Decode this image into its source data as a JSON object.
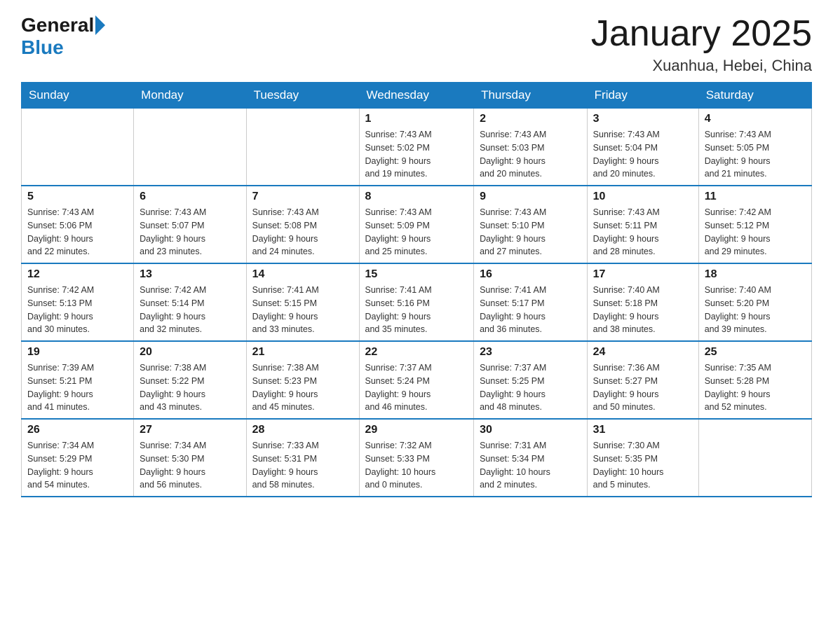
{
  "logo": {
    "general": "General",
    "blue": "Blue"
  },
  "title": "January 2025",
  "location": "Xuanhua, Hebei, China",
  "days_of_week": [
    "Sunday",
    "Monday",
    "Tuesday",
    "Wednesday",
    "Thursday",
    "Friday",
    "Saturday"
  ],
  "weeks": [
    [
      {
        "day": "",
        "info": ""
      },
      {
        "day": "",
        "info": ""
      },
      {
        "day": "",
        "info": ""
      },
      {
        "day": "1",
        "info": "Sunrise: 7:43 AM\nSunset: 5:02 PM\nDaylight: 9 hours\nand 19 minutes."
      },
      {
        "day": "2",
        "info": "Sunrise: 7:43 AM\nSunset: 5:03 PM\nDaylight: 9 hours\nand 20 minutes."
      },
      {
        "day": "3",
        "info": "Sunrise: 7:43 AM\nSunset: 5:04 PM\nDaylight: 9 hours\nand 20 minutes."
      },
      {
        "day": "4",
        "info": "Sunrise: 7:43 AM\nSunset: 5:05 PM\nDaylight: 9 hours\nand 21 minutes."
      }
    ],
    [
      {
        "day": "5",
        "info": "Sunrise: 7:43 AM\nSunset: 5:06 PM\nDaylight: 9 hours\nand 22 minutes."
      },
      {
        "day": "6",
        "info": "Sunrise: 7:43 AM\nSunset: 5:07 PM\nDaylight: 9 hours\nand 23 minutes."
      },
      {
        "day": "7",
        "info": "Sunrise: 7:43 AM\nSunset: 5:08 PM\nDaylight: 9 hours\nand 24 minutes."
      },
      {
        "day": "8",
        "info": "Sunrise: 7:43 AM\nSunset: 5:09 PM\nDaylight: 9 hours\nand 25 minutes."
      },
      {
        "day": "9",
        "info": "Sunrise: 7:43 AM\nSunset: 5:10 PM\nDaylight: 9 hours\nand 27 minutes."
      },
      {
        "day": "10",
        "info": "Sunrise: 7:43 AM\nSunset: 5:11 PM\nDaylight: 9 hours\nand 28 minutes."
      },
      {
        "day": "11",
        "info": "Sunrise: 7:42 AM\nSunset: 5:12 PM\nDaylight: 9 hours\nand 29 minutes."
      }
    ],
    [
      {
        "day": "12",
        "info": "Sunrise: 7:42 AM\nSunset: 5:13 PM\nDaylight: 9 hours\nand 30 minutes."
      },
      {
        "day": "13",
        "info": "Sunrise: 7:42 AM\nSunset: 5:14 PM\nDaylight: 9 hours\nand 32 minutes."
      },
      {
        "day": "14",
        "info": "Sunrise: 7:41 AM\nSunset: 5:15 PM\nDaylight: 9 hours\nand 33 minutes."
      },
      {
        "day": "15",
        "info": "Sunrise: 7:41 AM\nSunset: 5:16 PM\nDaylight: 9 hours\nand 35 minutes."
      },
      {
        "day": "16",
        "info": "Sunrise: 7:41 AM\nSunset: 5:17 PM\nDaylight: 9 hours\nand 36 minutes."
      },
      {
        "day": "17",
        "info": "Sunrise: 7:40 AM\nSunset: 5:18 PM\nDaylight: 9 hours\nand 38 minutes."
      },
      {
        "day": "18",
        "info": "Sunrise: 7:40 AM\nSunset: 5:20 PM\nDaylight: 9 hours\nand 39 minutes."
      }
    ],
    [
      {
        "day": "19",
        "info": "Sunrise: 7:39 AM\nSunset: 5:21 PM\nDaylight: 9 hours\nand 41 minutes."
      },
      {
        "day": "20",
        "info": "Sunrise: 7:38 AM\nSunset: 5:22 PM\nDaylight: 9 hours\nand 43 minutes."
      },
      {
        "day": "21",
        "info": "Sunrise: 7:38 AM\nSunset: 5:23 PM\nDaylight: 9 hours\nand 45 minutes."
      },
      {
        "day": "22",
        "info": "Sunrise: 7:37 AM\nSunset: 5:24 PM\nDaylight: 9 hours\nand 46 minutes."
      },
      {
        "day": "23",
        "info": "Sunrise: 7:37 AM\nSunset: 5:25 PM\nDaylight: 9 hours\nand 48 minutes."
      },
      {
        "day": "24",
        "info": "Sunrise: 7:36 AM\nSunset: 5:27 PM\nDaylight: 9 hours\nand 50 minutes."
      },
      {
        "day": "25",
        "info": "Sunrise: 7:35 AM\nSunset: 5:28 PM\nDaylight: 9 hours\nand 52 minutes."
      }
    ],
    [
      {
        "day": "26",
        "info": "Sunrise: 7:34 AM\nSunset: 5:29 PM\nDaylight: 9 hours\nand 54 minutes."
      },
      {
        "day": "27",
        "info": "Sunrise: 7:34 AM\nSunset: 5:30 PM\nDaylight: 9 hours\nand 56 minutes."
      },
      {
        "day": "28",
        "info": "Sunrise: 7:33 AM\nSunset: 5:31 PM\nDaylight: 9 hours\nand 58 minutes."
      },
      {
        "day": "29",
        "info": "Sunrise: 7:32 AM\nSunset: 5:33 PM\nDaylight: 10 hours\nand 0 minutes."
      },
      {
        "day": "30",
        "info": "Sunrise: 7:31 AM\nSunset: 5:34 PM\nDaylight: 10 hours\nand 2 minutes."
      },
      {
        "day": "31",
        "info": "Sunrise: 7:30 AM\nSunset: 5:35 PM\nDaylight: 10 hours\nand 5 minutes."
      },
      {
        "day": "",
        "info": ""
      }
    ]
  ]
}
